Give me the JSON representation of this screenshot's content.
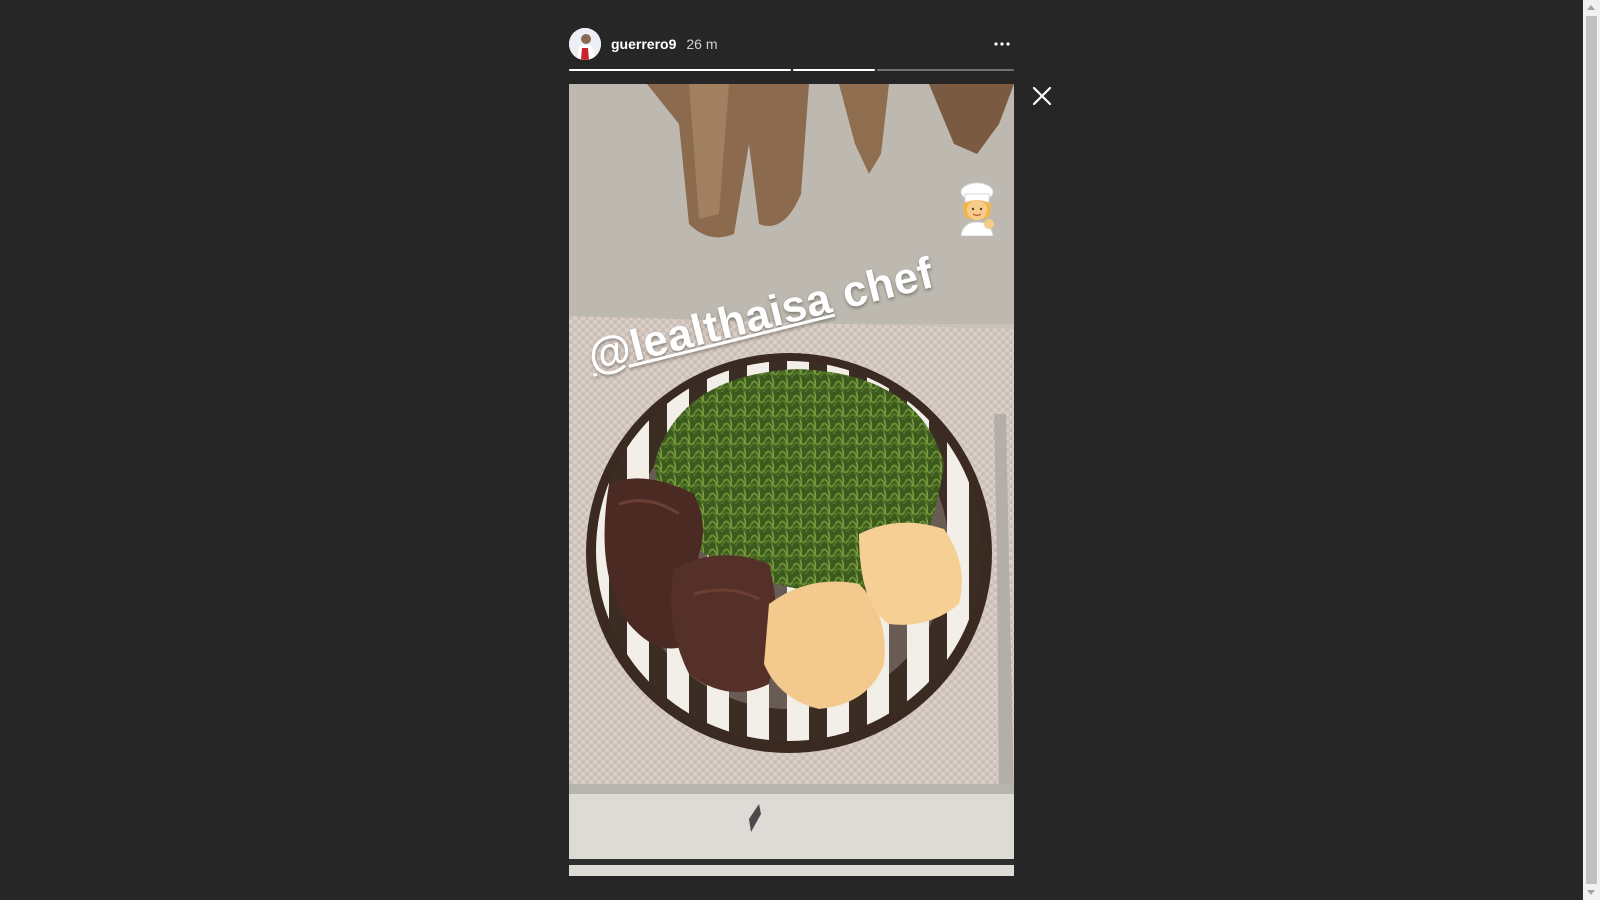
{
  "story": {
    "username": "guerrero9",
    "timestamp": "26 m",
    "caption_mention": "@lealthaisa",
    "caption_text": "chef",
    "progress": [
      {
        "state": "viewed",
        "fill": 1.0
      },
      {
        "state": "current",
        "fill": 1.0
      },
      {
        "state": "upcoming",
        "fill": 0.0
      }
    ]
  },
  "icons": {
    "more": "more-options-icon",
    "close": "close-icon",
    "chef": "chef-emoji-icon"
  },
  "colors": {
    "background": "#262626",
    "text": "#ffffff",
    "muted": "#cfcfcf"
  }
}
